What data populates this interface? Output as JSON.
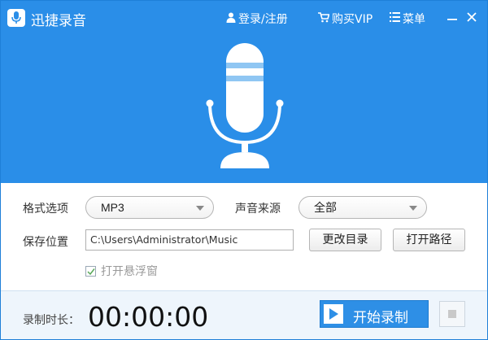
{
  "app": {
    "title": "迅捷录音"
  },
  "titlebar": {
    "login_label": "登录/注册",
    "vip_label": "购买VIP",
    "menu_label": "菜单"
  },
  "icons": {
    "logo": "microphone-icon",
    "login": "user-icon",
    "vip": "cart-icon",
    "menu": "menu-icon",
    "minimize": "minimize-icon",
    "close": "close-icon",
    "hero": "microphone-icon",
    "checkbox": "check-icon",
    "play": "play-icon",
    "stop": "stop-icon"
  },
  "colors": {
    "primary": "#2a8ee8",
    "button_blue": "#2e8fe6",
    "bottom_bar": "#eef5fc"
  },
  "form": {
    "format_label": "格式选项",
    "format_value": "MP3",
    "source_label": "声音来源",
    "source_value": "全部",
    "save_label": "保存位置",
    "save_path": "C:\\Users\\Administrator\\Music",
    "change_dir_label": "更改目录",
    "open_path_label": "打开路径",
    "float_window_label": "打开悬浮窗",
    "float_window_checked": true
  },
  "bottom": {
    "duration_label": "录制时长：",
    "timer": "00:00:00",
    "start_label": "开始录制"
  }
}
